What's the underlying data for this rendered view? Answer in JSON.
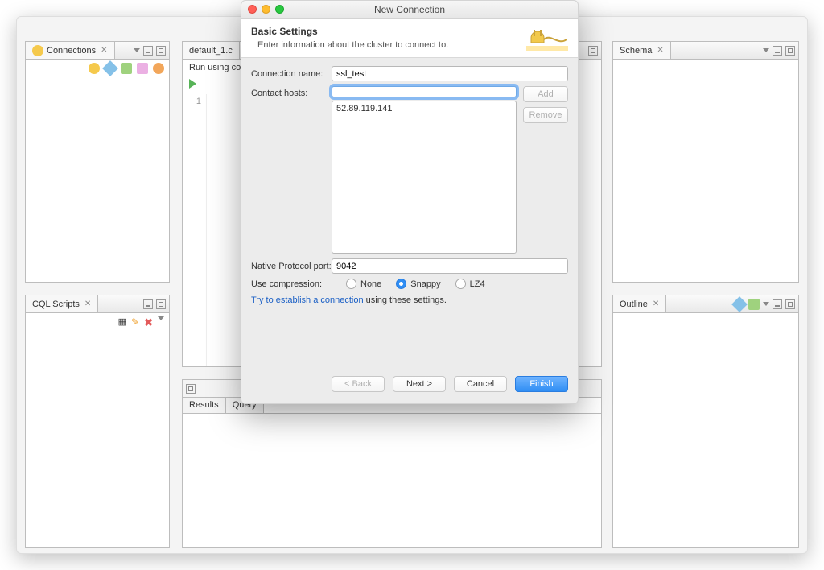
{
  "panels": {
    "connections": {
      "title": "Connections"
    },
    "cqlscripts": {
      "title": "CQL Scripts"
    },
    "editor": {
      "tab": "default_1.c",
      "runbar": "Run using conn",
      "line": "1"
    },
    "results": {
      "tabs": [
        "Results",
        "Query"
      ]
    },
    "schema": {
      "title": "Schema"
    },
    "outline": {
      "title": "Outline"
    }
  },
  "dialog": {
    "window_title": "New Connection",
    "heading": "Basic Settings",
    "subheading": "Enter information about the cluster to connect to.",
    "labels": {
      "connection_name": "Connection name:",
      "contact_hosts": "Contact hosts:",
      "native_port": "Native Protocol port:",
      "compression": "Use compression:"
    },
    "values": {
      "connection_name": "ssl_test",
      "contact_hosts_input": "",
      "hosts": [
        "52.89.119.141"
      ],
      "native_port": "9042"
    },
    "buttons": {
      "add": "Add",
      "remove": "Remove",
      "back": "< Back",
      "next": "Next >",
      "cancel": "Cancel",
      "finish": "Finish"
    },
    "compression_options": {
      "none": "None",
      "snappy": "Snappy",
      "lz4": "LZ4",
      "selected": "snappy"
    },
    "test_link": "Try to establish a connection",
    "test_link_tail": " using these settings."
  }
}
